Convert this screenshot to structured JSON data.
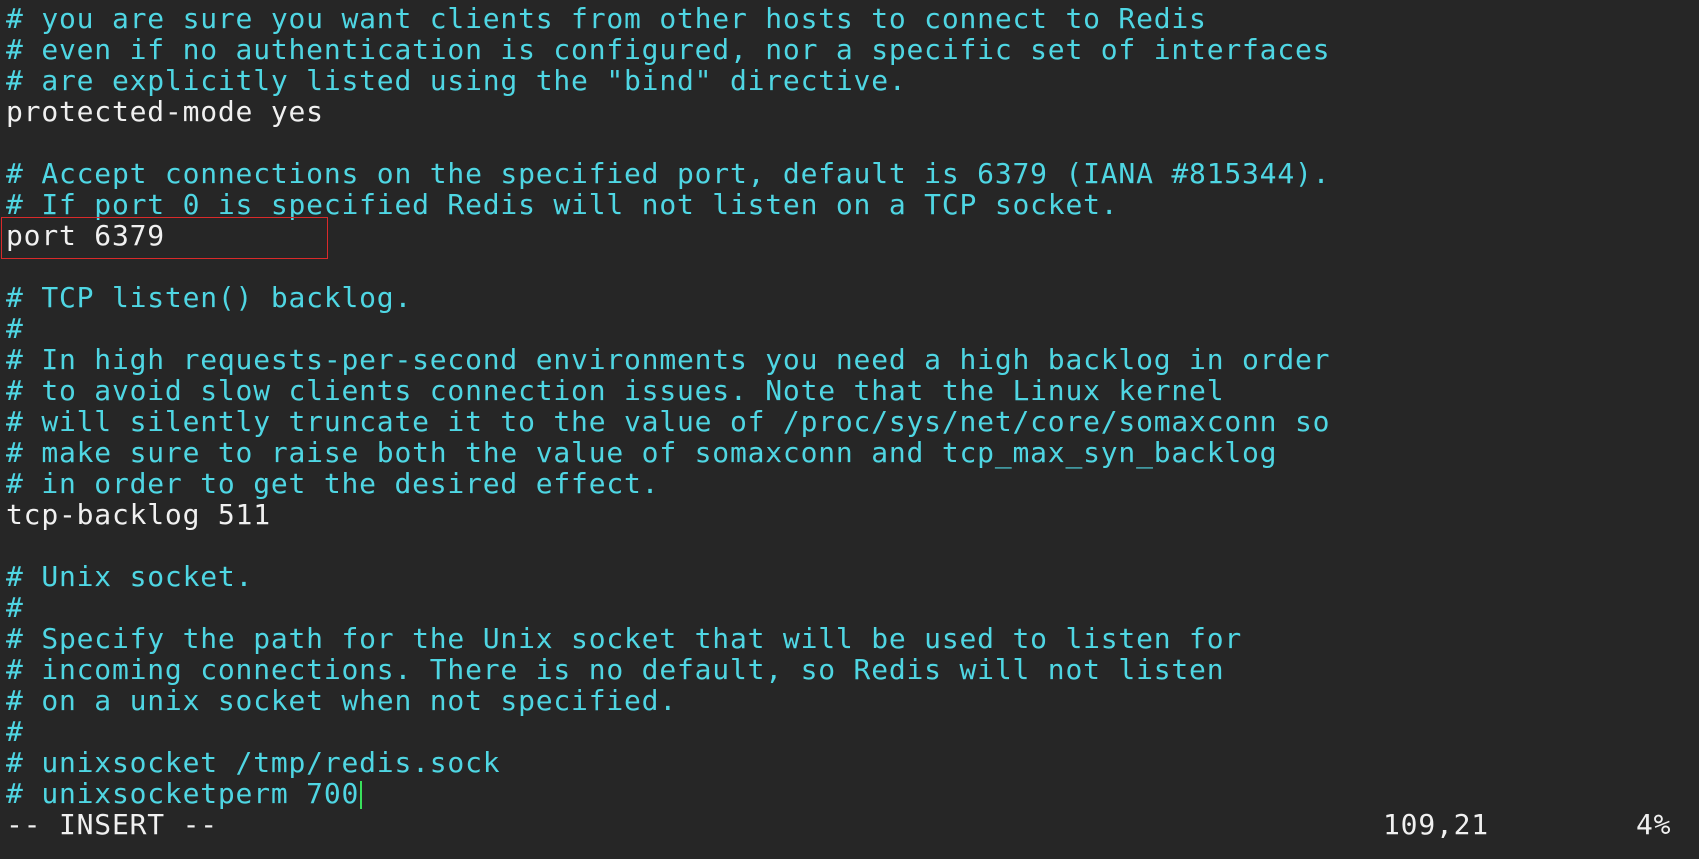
{
  "editor": {
    "lines": [
      {
        "text": "# you are sure you want clients from other hosts to connect to Redis",
        "kind": "comment"
      },
      {
        "text": "# even if no authentication is configured, nor a specific set of interfaces",
        "kind": "comment"
      },
      {
        "text": "# are explicitly listed using the \"bind\" directive.",
        "kind": "comment"
      },
      {
        "text": "protected-mode yes",
        "kind": "setting"
      },
      {
        "text": "",
        "kind": "blank"
      },
      {
        "text": "# Accept connections on the specified port, default is 6379 (IANA #815344).",
        "kind": "comment"
      },
      {
        "text": "# If port 0 is specified Redis will not listen on a TCP socket.",
        "kind": "comment"
      },
      {
        "text": "port 6379",
        "kind": "setting"
      },
      {
        "text": "",
        "kind": "blank"
      },
      {
        "text": "# TCP listen() backlog.",
        "kind": "comment"
      },
      {
        "text": "#",
        "kind": "comment"
      },
      {
        "text": "# In high requests-per-second environments you need a high backlog in order",
        "kind": "comment"
      },
      {
        "text": "# to avoid slow clients connection issues. Note that the Linux kernel",
        "kind": "comment"
      },
      {
        "text": "# will silently truncate it to the value of /proc/sys/net/core/somaxconn so",
        "kind": "comment"
      },
      {
        "text": "# make sure to raise both the value of somaxconn and tcp_max_syn_backlog",
        "kind": "comment"
      },
      {
        "text": "# in order to get the desired effect.",
        "kind": "comment"
      },
      {
        "text": "tcp-backlog 511",
        "kind": "setting"
      },
      {
        "text": "",
        "kind": "blank"
      },
      {
        "text": "# Unix socket.",
        "kind": "comment"
      },
      {
        "text": "#",
        "kind": "comment"
      },
      {
        "text": "# Specify the path for the Unix socket that will be used to listen for",
        "kind": "comment"
      },
      {
        "text": "# incoming connections. There is no default, so Redis will not listen",
        "kind": "comment"
      },
      {
        "text": "# on a unix socket when not specified.",
        "kind": "comment"
      },
      {
        "text": "#",
        "kind": "comment"
      },
      {
        "text": "# unixsocket /tmp/redis.sock",
        "kind": "comment"
      },
      {
        "text": "# unixsocketperm 700",
        "kind": "comment"
      }
    ],
    "highlighted_line_index": 7,
    "cursor_line_index": 25
  },
  "statusline": {
    "mode": "-- INSERT --",
    "position": "109,21",
    "percent": "4%"
  },
  "colors": {
    "background": "#262626",
    "comment": "#4fd6e3",
    "text": "#f0f0f0",
    "cursor": "#39e05b",
    "highlight_box": "#d92a2a"
  }
}
